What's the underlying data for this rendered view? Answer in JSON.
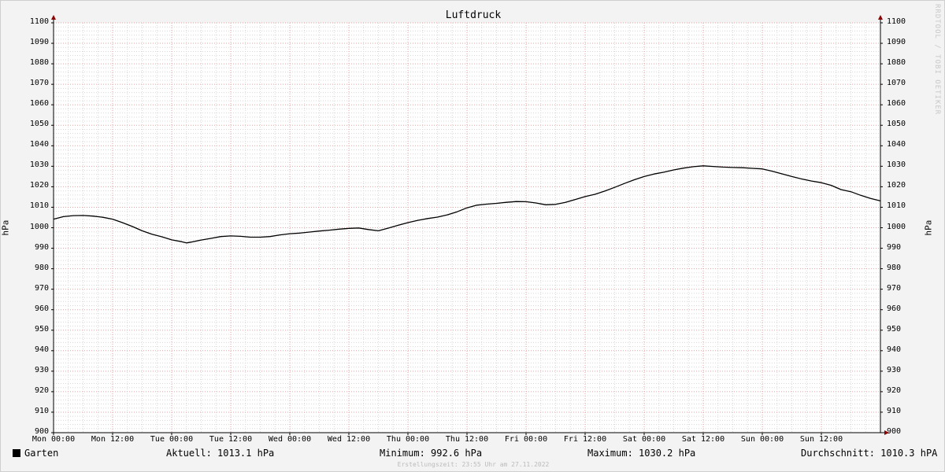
{
  "chart_data": {
    "type": "line",
    "title": "Luftdruck",
    "ylabel": "hPa",
    "ylim": [
      900,
      1100
    ],
    "y_major_step": 10,
    "y_minor_step": 2,
    "x_hours_range": [
      0,
      168
    ],
    "x_ticks": [
      {
        "h": 0,
        "label": "Mon 00:00"
      },
      {
        "h": 12,
        "label": "Mon 12:00"
      },
      {
        "h": 24,
        "label": "Tue 00:00"
      },
      {
        "h": 36,
        "label": "Tue 12:00"
      },
      {
        "h": 48,
        "label": "Wed 00:00"
      },
      {
        "h": 60,
        "label": "Wed 12:00"
      },
      {
        "h": 72,
        "label": "Thu 00:00"
      },
      {
        "h": 84,
        "label": "Thu 12:00"
      },
      {
        "h": 96,
        "label": "Fri 00:00"
      },
      {
        "h": 108,
        "label": "Fri 12:00"
      },
      {
        "h": 120,
        "label": "Sat 00:00"
      },
      {
        "h": 132,
        "label": "Sat 12:00"
      },
      {
        "h": 144,
        "label": "Sun 00:00"
      },
      {
        "h": 156,
        "label": "Sun 12:00"
      }
    ],
    "grid": true,
    "series": [
      {
        "name": "Garten",
        "color": "#000000",
        "points": [
          [
            0,
            1004.2
          ],
          [
            2,
            1005.4
          ],
          [
            4,
            1005.9
          ],
          [
            6,
            1006.0
          ],
          [
            8,
            1005.7
          ],
          [
            10,
            1005.1
          ],
          [
            12,
            1004.2
          ],
          [
            14,
            1002.5
          ],
          [
            16,
            1000.6
          ],
          [
            18,
            998.5
          ],
          [
            20,
            996.8
          ],
          [
            22,
            995.6
          ],
          [
            24,
            994.1
          ],
          [
            26,
            993.2
          ],
          [
            27,
            992.6
          ],
          [
            28,
            993.0
          ],
          [
            30,
            994.0
          ],
          [
            32,
            994.8
          ],
          [
            34,
            995.7
          ],
          [
            36,
            996.0
          ],
          [
            38,
            995.8
          ],
          [
            40,
            995.4
          ],
          [
            42,
            995.4
          ],
          [
            44,
            995.7
          ],
          [
            46,
            996.5
          ],
          [
            48,
            997.1
          ],
          [
            50,
            997.4
          ],
          [
            52,
            997.9
          ],
          [
            54,
            998.4
          ],
          [
            56,
            998.8
          ],
          [
            58,
            999.3
          ],
          [
            60,
            999.7
          ],
          [
            62,
            999.9
          ],
          [
            64,
            999.1
          ],
          [
            66,
            998.5
          ],
          [
            68,
            999.8
          ],
          [
            70,
            1001.2
          ],
          [
            72,
            1002.5
          ],
          [
            74,
            1003.6
          ],
          [
            76,
            1004.5
          ],
          [
            78,
            1005.2
          ],
          [
            80,
            1006.3
          ],
          [
            82,
            1007.8
          ],
          [
            84,
            1009.7
          ],
          [
            86,
            1011.0
          ],
          [
            88,
            1011.5
          ],
          [
            90,
            1011.9
          ],
          [
            92,
            1012.4
          ],
          [
            94,
            1012.8
          ],
          [
            96,
            1012.7
          ],
          [
            98,
            1012.1
          ],
          [
            100,
            1011.2
          ],
          [
            102,
            1011.4
          ],
          [
            104,
            1012.4
          ],
          [
            106,
            1013.8
          ],
          [
            108,
            1015.2
          ],
          [
            110,
            1016.3
          ],
          [
            112,
            1017.9
          ],
          [
            114,
            1019.7
          ],
          [
            116,
            1021.6
          ],
          [
            118,
            1023.4
          ],
          [
            120,
            1025.0
          ],
          [
            122,
            1026.2
          ],
          [
            124,
            1027.1
          ],
          [
            126,
            1028.2
          ],
          [
            128,
            1029.1
          ],
          [
            130,
            1029.8
          ],
          [
            132,
            1030.2
          ],
          [
            134,
            1029.9
          ],
          [
            136,
            1029.6
          ],
          [
            138,
            1029.4
          ],
          [
            140,
            1029.3
          ],
          [
            142,
            1029.0
          ],
          [
            144,
            1028.7
          ],
          [
            146,
            1027.6
          ],
          [
            148,
            1026.3
          ],
          [
            150,
            1025.0
          ],
          [
            152,
            1023.8
          ],
          [
            154,
            1022.8
          ],
          [
            156,
            1022.0
          ],
          [
            158,
            1020.7
          ],
          [
            160,
            1018.6
          ],
          [
            162,
            1017.6
          ],
          [
            164,
            1015.8
          ],
          [
            166,
            1014.3
          ],
          [
            168,
            1013.1
          ]
        ]
      }
    ]
  },
  "legend": {
    "series_name": "Garten",
    "current": "Aktuell: 1013.1 hPa",
    "minimum": "Minimum: 992.6 hPa",
    "maximum": "Maximum: 1030.2 hPa",
    "average": "Durchschnitt: 1010.3 hPA"
  },
  "watermark": "RRDTOOL / TOBI OETIKER",
  "created": "Erstellungszeit: 23:55 Uhr am 27.11.2022"
}
